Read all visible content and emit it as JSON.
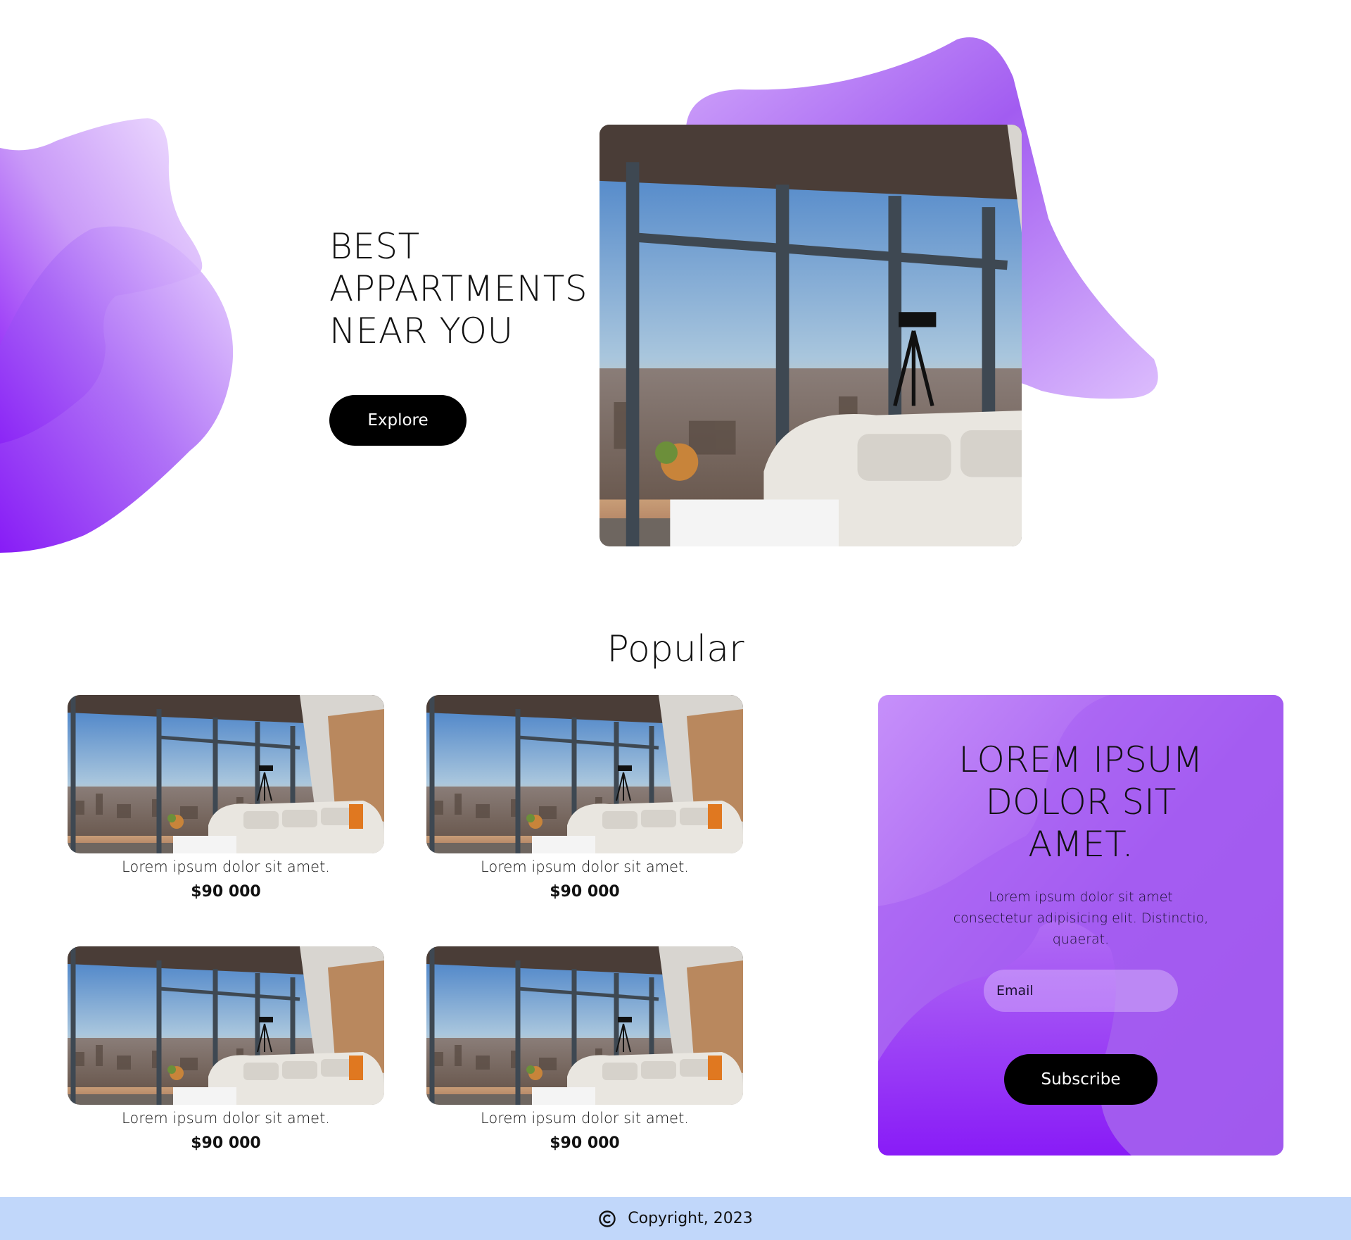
{
  "hero": {
    "title_lines": [
      "BEST",
      "APPARTMENTS",
      "NEAR YOU"
    ],
    "explore_label": "Explore"
  },
  "popular": {
    "title": "Popular",
    "cards": [
      {
        "name": "Lorem ipsum dolor sit amet.",
        "price": "$90 000"
      },
      {
        "name": "Lorem ipsum dolor sit amet.",
        "price": "$90 000"
      },
      {
        "name": "Lorem ipsum dolor sit amet.",
        "price": "$90 000"
      },
      {
        "name": "Lorem ipsum dolor sit amet.",
        "price": "$90 000"
      }
    ]
  },
  "subscribe": {
    "title_lines": [
      "LOREM IPSUM",
      "DOLOR SIT",
      "AMET."
    ],
    "text": "Lorem ipsum dolor sit amet consectetur adipisicing elit. Distinctio, quaerat.",
    "email_placeholder": "Email",
    "button_label": "Subscribe"
  },
  "footer": {
    "copyright": "Copyright, 2023"
  },
  "colors": {
    "purple_light": "#d9b8fb",
    "purple_mid": "#a05cf0",
    "purple_deep": "#8410f8",
    "footer_bg": "#c1d7fa",
    "button_bg": "#000000"
  }
}
